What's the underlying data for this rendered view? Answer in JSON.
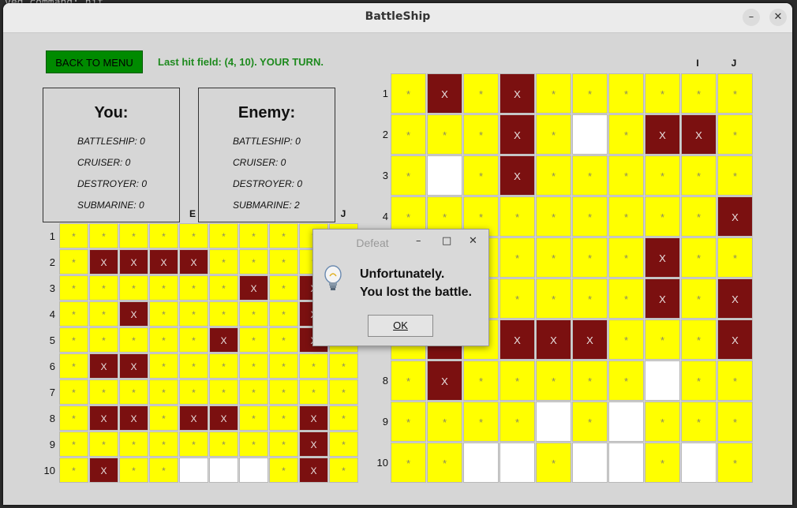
{
  "terminal": {
    "command_fragment": "ved command: hit"
  },
  "window": {
    "title": "BattleShip",
    "minimize_glyph": "–",
    "close_glyph": "✕"
  },
  "toolbar": {
    "back_label": "BACK TO MENU",
    "status_text": "Last hit field: (4, 10).  YOUR TURN."
  },
  "you_panel": {
    "title": "You:",
    "lines": [
      "BATTLESHIP: 0",
      "CRUISER: 0",
      "DESTROYER: 0",
      "SUBMARINE: 0"
    ]
  },
  "enemy_panel": {
    "title": "Enemy:",
    "lines": [
      "BATTLESHIP: 0",
      "CRUISER: 0",
      "DESTROYER: 0",
      "SUBMARINE: 2"
    ]
  },
  "labels": {
    "rows": [
      "1",
      "2",
      "3",
      "4",
      "5",
      "6",
      "7",
      "8",
      "9",
      "10"
    ],
    "player_cols_visible": {
      "E": "E",
      "J": "J"
    },
    "enemy_cols_visible": {
      "I": "I",
      "J": "J"
    },
    "miss_mark": "*",
    "hit_mark": "X"
  },
  "player_board": [
    "yyyyyyyyyy",
    "yhhhhyyyyy",
    "yyyyyyhyhy",
    "yyhyyyyyhy",
    "yyyyyhyyhy",
    "yhhyyyyyyy",
    "yyyyyyyyyy",
    "yhhyhhyyhy",
    "yyyyyyyyhy",
    "yhyywwwyhy"
  ],
  "enemy_board": [
    "yhyhyyyyyy",
    "yyyhywyhhy",
    "ywyhyyyyyy",
    "yyyyyyyyyh",
    "yyyyyyyhyy",
    "yyyyyyyhyh",
    "yhyhhhyyyh",
    "yhyyyyywyy",
    "yyyywywyyy",
    "yywwywwywy"
  ],
  "dialog": {
    "title": "Defeat",
    "minimize_glyph": "–",
    "maximize_glyph": "□",
    "close_glyph": "✕",
    "line1": "Unfortunately.",
    "line2": "You lost the battle.",
    "ok_label": "OK",
    "icon": "lightbulb-icon"
  }
}
